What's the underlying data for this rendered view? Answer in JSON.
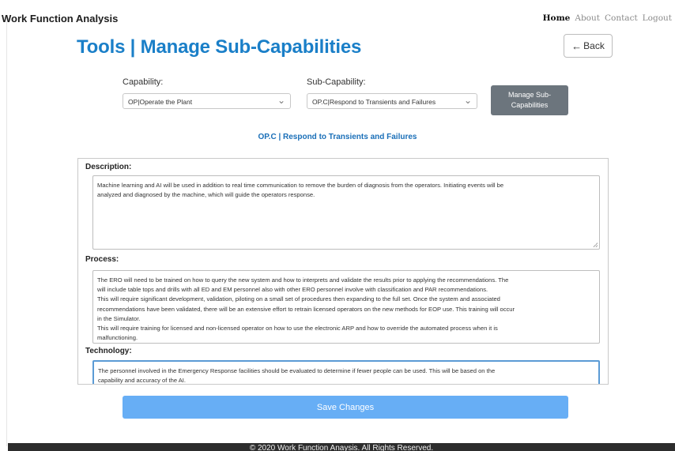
{
  "nav": {
    "brand": "Work Function Analysis",
    "links": [
      "Home",
      "About",
      "Contact",
      "Logout"
    ]
  },
  "page": {
    "title": "Tools | Manage Sub-Capabilities",
    "back_label": "Back"
  },
  "filters": {
    "capability_label": "Capability:",
    "capability_value": "OP|Operate the Plant",
    "subcapability_label": "Sub-Capability:",
    "subcapability_value": "OP.C|Respond to Transients and Failures",
    "manage_button_line1": "Manage Sub-",
    "manage_button_line2": "Capabilities"
  },
  "selected_title": "OP.C | Respond to Transients and Failures",
  "sections": {
    "description_label": "Description:",
    "description_lines": [
      "Machine learning and AI will be used in addition to real time communication to remove the burden of diagnosis from the operators.  Initiating events will be",
      "analyzed and diagnosed by the machine, which will guide the operators response."
    ],
    "process_label": "Process:",
    "process_lines": [
      "The ERO will need to be trained on how to query the new system and how to interprets and validate the results prior to applying the recommendations.  The",
      "will include table tops and drills with all ED and EM personnel also with other ERO personnel involve with classification and PAR recommendations.",
      "This will require significant development, validation, piloting on a small set of procedures then expanding to the full set.  Once the system and associated",
      "recommendations have been validated, there will be an extensive effort to retrain licensed operators on the new methods for EOP use. This training will occur",
      "in the Simulator.",
      "This will require training for licensed and non-licensed operator on how to use the electronic ARP and how to override the automated process when it is",
      "malfunctioning."
    ],
    "technology_label": "Technology:",
    "technology_lines": [
      "The personnel involved in the Emergency Response facilities should be evaluated to determine if fewer people can be used.  This will be based on the",
      "capability and accuracy of the AI."
    ]
  },
  "save_label": "Save Changes",
  "footer": "© 2020 Work Function Anaysis. All Rights Reserved.",
  "colors": {
    "title_blue": "#1a7fc8",
    "save_button": "#67aef5",
    "manage_button": "#6c757d",
    "footer_bg": "#2d2d2d"
  }
}
